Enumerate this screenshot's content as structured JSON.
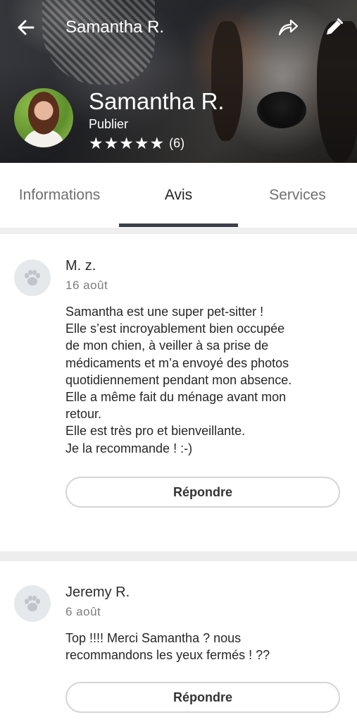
{
  "header": {
    "title": "Samantha R.",
    "name": "Samantha R.",
    "role": "Publier",
    "stars": "★★★★★",
    "rating_count": "(6)",
    "rating_value": 5
  },
  "icons": {
    "back": "arrow-left-icon",
    "share": "share-icon",
    "edit": "pencil-icon",
    "paw": "paw-icon"
  },
  "tabs": [
    {
      "label": "Informations",
      "active": false
    },
    {
      "label": "Avis",
      "active": true
    },
    {
      "label": "Services",
      "active": false
    }
  ],
  "reviews": [
    {
      "author": "M. z.",
      "date": "16 août",
      "lines": [
        "Samantha est une super pet-sitter !",
        "Elle s’est incroyablement bien occupée",
        "de mon chien, à veiller à sa prise de",
        "médicaments et m’a envoyé des photos",
        "quotidiennement pendant mon absence.",
        "Elle a même fait du ménage avant mon",
        "retour.",
        "Elle est très pro et bienveillante.",
        "Je la recommande ! :-)"
      ],
      "reply_label": "Répondre"
    },
    {
      "author": "Jeremy R.",
      "date": "6 août",
      "lines": [
        "Top !!!! Merci Samantha ? nous",
        "recommandons les yeux fermés ! ??"
      ],
      "reply_label": "Répondre"
    }
  ],
  "colors": {
    "tab_underline": "#3a3f4a",
    "page_background": "#ededed",
    "avatar_placeholder": "#e6e9ec",
    "button_border": "#d3d5d9"
  }
}
